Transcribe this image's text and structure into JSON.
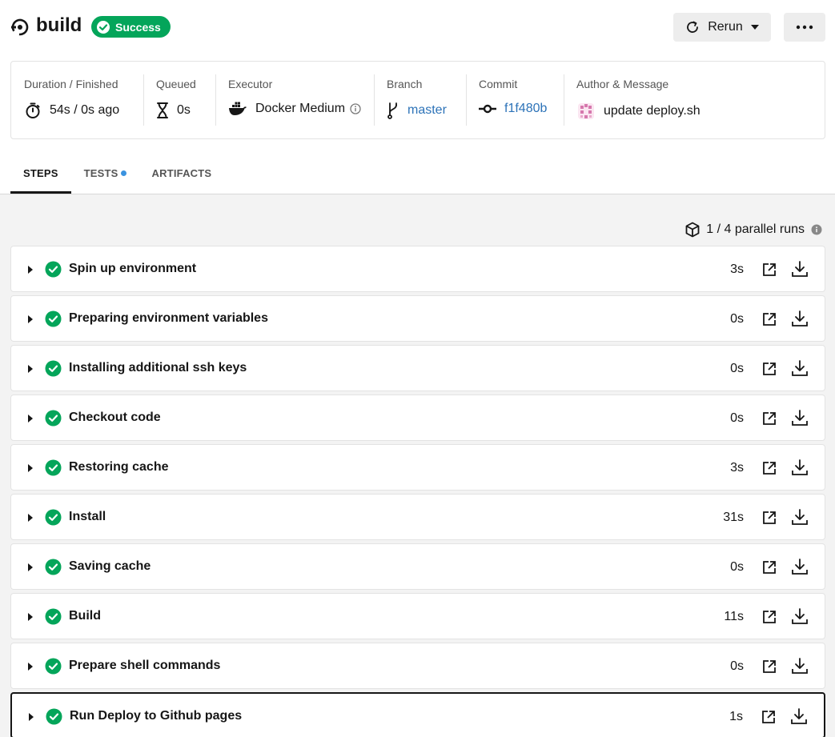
{
  "job": {
    "title": "build",
    "status": "Success"
  },
  "actions": {
    "rerun_label": "Rerun"
  },
  "info": {
    "duration": {
      "label": "Duration / Finished",
      "value": "54s / 0s ago"
    },
    "queued": {
      "label": "Queued",
      "value": "0s"
    },
    "executor": {
      "label": "Executor",
      "value": "Docker Medium"
    },
    "branch": {
      "label": "Branch",
      "value": "master"
    },
    "commit": {
      "label": "Commit",
      "value": "f1f480b"
    },
    "author": {
      "label": "Author & Message",
      "value": "update deploy.sh"
    }
  },
  "tabs": [
    {
      "label": "STEPS",
      "active": true
    },
    {
      "label": "TESTS",
      "active": false
    },
    {
      "label": "ARTIFACTS",
      "active": false
    }
  ],
  "parallel_runs": "1 / 4 parallel runs",
  "steps": [
    {
      "name": "Spin up environment",
      "duration": "3s"
    },
    {
      "name": "Preparing environment variables",
      "duration": "0s"
    },
    {
      "name": "Installing additional ssh keys",
      "duration": "0s"
    },
    {
      "name": "Checkout code",
      "duration": "0s"
    },
    {
      "name": "Restoring cache",
      "duration": "3s"
    },
    {
      "name": "Install",
      "duration": "31s"
    },
    {
      "name": "Saving cache",
      "duration": "0s"
    },
    {
      "name": "Build",
      "duration": "11s"
    },
    {
      "name": "Prepare shell commands",
      "duration": "0s"
    },
    {
      "name": "Run Deploy to Github pages",
      "duration": "1s"
    }
  ],
  "colors": {
    "success": "#04a55a",
    "link": "#2d73b8",
    "tests_dot": "#3a93e0"
  },
  "icons": {
    "logo": "circleci-logo-icon",
    "status": "check-circle-icon",
    "rerun": "refresh-icon",
    "dropdown": "caret-down-icon",
    "more": "more-horizontal-icon",
    "duration": "stopwatch-icon",
    "queued": "hourglass-icon",
    "executor": "docker-icon",
    "info": "info-icon",
    "branch": "git-branch-icon",
    "commit": "git-commit-icon",
    "author": "avatar-icon",
    "parallel": "cube-icon",
    "expand": "caret-right-icon",
    "open": "external-link-icon",
    "download": "download-icon"
  }
}
